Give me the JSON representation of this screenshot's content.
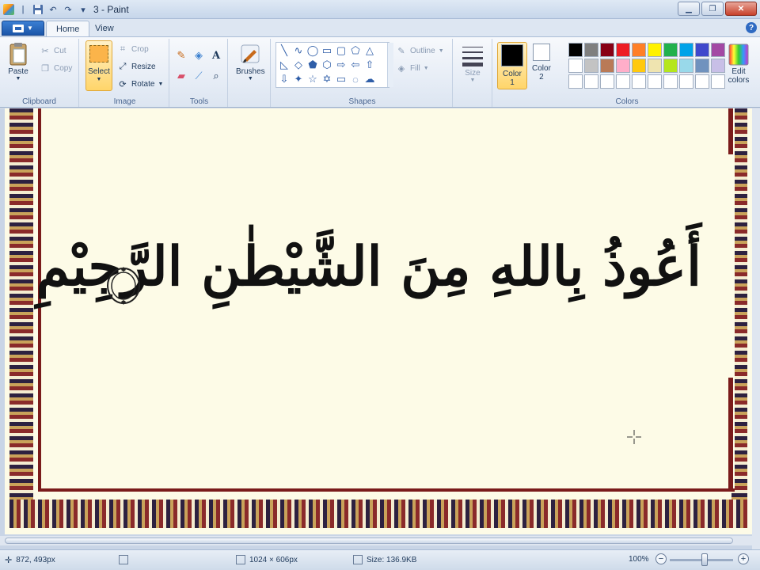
{
  "title": "3 - Paint",
  "tabs": {
    "home": "Home",
    "view": "View"
  },
  "clipboard": {
    "group": "Clipboard",
    "paste": "Paste",
    "cut": "Cut",
    "copy": "Copy"
  },
  "image": {
    "group": "Image",
    "select": "Select",
    "crop": "Crop",
    "resize": "Resize",
    "rotate": "Rotate"
  },
  "tools": {
    "group": "Tools",
    "text_tool": "A"
  },
  "brushes": {
    "label": "Brushes"
  },
  "shapes": {
    "group": "Shapes",
    "outline": "Outline",
    "fill": "Fill"
  },
  "size": {
    "label": "Size"
  },
  "colors": {
    "group": "Colors",
    "color1_label": "Color",
    "color1_num": "1",
    "color2_label": "Color",
    "color2_num": "2",
    "edit_label": "Edit",
    "edit_label2": "colors",
    "color1": "#000000",
    "color2": "#ffffff",
    "palette": [
      "#000000",
      "#7f7f7f",
      "#880015",
      "#ed1c24",
      "#ff7f27",
      "#fff200",
      "#22b14c",
      "#00a2e8",
      "#3f48cc",
      "#a349a4",
      "#ffffff",
      "#c3c3c3",
      "#b97a57",
      "#ffaec9",
      "#ffc90e",
      "#efe4b0",
      "#b5e61d",
      "#99d9ea",
      "#7092be",
      "#c8bfe7",
      "#ffffff",
      "#ffffff",
      "#ffffff",
      "#ffffff",
      "#ffffff",
      "#ffffff",
      "#ffffff",
      "#ffffff",
      "#ffffff",
      "#ffffff"
    ]
  },
  "canvas": {
    "calligraphy_text": "أَعُوذُ بِاللهِ مِنَ الشَّيْطٰنِ الرَّجِيْمِ"
  },
  "status": {
    "cursor_pos": "872, 493px",
    "dimensions": "1024 × 606px",
    "file_size": "Size: 136.9KB",
    "zoom": "100%"
  }
}
